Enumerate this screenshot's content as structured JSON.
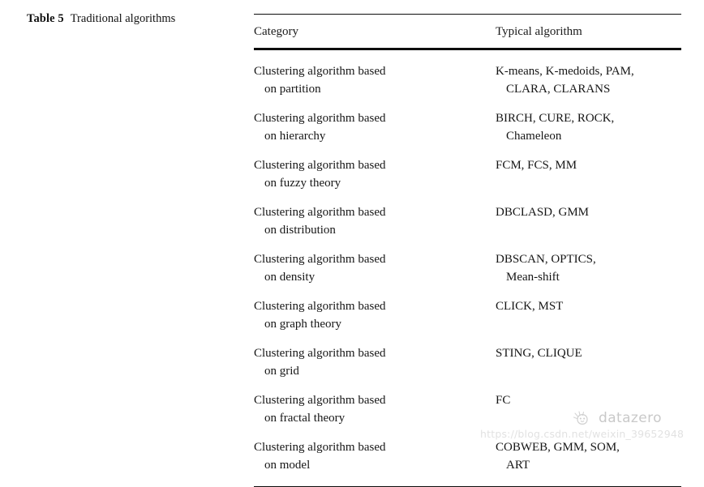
{
  "caption": {
    "label": "Table 5",
    "title": "Traditional algorithms"
  },
  "table": {
    "headers": {
      "category": "Category",
      "algorithm": "Typical algorithm"
    },
    "rows": [
      {
        "category_line1": "Clustering algorithm based",
        "category_line2": "on partition",
        "algorithm_line1": "K-means, K-medoids, PAM,",
        "algorithm_line2": "CLARA, CLARANS"
      },
      {
        "category_line1": "Clustering algorithm based",
        "category_line2": "on hierarchy",
        "algorithm_line1": "BIRCH, CURE, ROCK,",
        "algorithm_line2": "Chameleon"
      },
      {
        "category_line1": "Clustering algorithm based",
        "category_line2": "on fuzzy theory",
        "algorithm_line1": "FCM, FCS, MM",
        "algorithm_line2": ""
      },
      {
        "category_line1": "Clustering algorithm based",
        "category_line2": "on distribution",
        "algorithm_line1": "DBCLASD, GMM",
        "algorithm_line2": ""
      },
      {
        "category_line1": "Clustering algorithm based",
        "category_line2": "on density",
        "algorithm_line1": "DBSCAN, OPTICS,",
        "algorithm_line2": "Mean-shift"
      },
      {
        "category_line1": "Clustering algorithm based",
        "category_line2": "on graph theory",
        "algorithm_line1": "CLICK, MST",
        "algorithm_line2": ""
      },
      {
        "category_line1": "Clustering algorithm based",
        "category_line2": "on grid",
        "algorithm_line1": "STING, CLIQUE",
        "algorithm_line2": ""
      },
      {
        "category_line1": "Clustering algorithm based",
        "category_line2": "on fractal theory",
        "algorithm_line1": "FC",
        "algorithm_line2": ""
      },
      {
        "category_line1": "Clustering algorithm based",
        "category_line2": "on model",
        "algorithm_line1": "COBWEB, GMM, SOM,",
        "algorithm_line2": "ART"
      }
    ]
  },
  "watermark": {
    "brand": "datazero",
    "url": "https://blog.csdn.net/weixin_39652948"
  },
  "colors": {
    "rule": "#0d0d0d",
    "text": "#161616",
    "watermark": "#c9c9c9",
    "watermark_url": "#e2e2e2",
    "background": "#ffffff"
  }
}
